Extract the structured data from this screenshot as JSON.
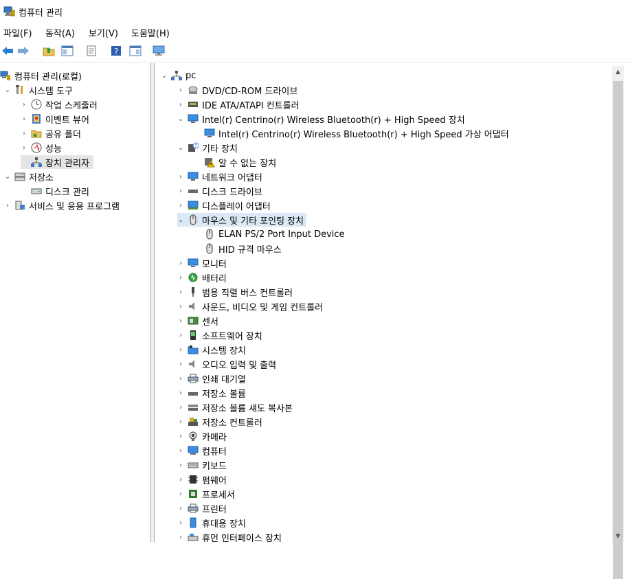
{
  "window": {
    "title": "컴퓨터 관리"
  },
  "menu": [
    "파일(F)",
    "동작(A)",
    "보기(V)",
    "도움말(H)"
  ],
  "toolbar": [
    "back-icon",
    "forward-icon",
    "up-folder-icon",
    "show-hide-tree-icon",
    "properties-icon",
    "help-icon",
    "action-pane-icon",
    "monitor-icon"
  ],
  "left_tree": {
    "root": "컴퓨터 관리(로컬)",
    "system_tools": "시스템 도구",
    "task_scheduler": "작업 스케줄러",
    "event_viewer": "이벤트 뷰어",
    "shared_folders": "공유 폴더",
    "performance": "성능",
    "device_manager": "장치 관리자",
    "storage": "저장소",
    "disk_management": "디스크 관리",
    "services_apps": "서비스 및 응용 프로그램"
  },
  "device_tree": {
    "root": "pc",
    "items": [
      "DVD/CD-ROM 드라이브",
      "IDE ATA/ATAPI 컨트롤러",
      "Intel(r) Centrino(r) Wireless Bluetooth(r) + High Speed 장치",
      "Intel(r) Centrino(r) Wireless Bluetooth(r) + High Speed 가상 어댑터",
      "기타 장치",
      "알 수 없는 장치",
      "네트워크 어댑터",
      "디스크 드라이브",
      "디스플레이 어댑터",
      "마우스 및 기타 포인팅 장치",
      "ELAN PS/2 Port Input Device",
      "HID 규격 마우스",
      "모니터",
      "배터리",
      "범용 직렬 버스 컨트롤러",
      "사운드, 비디오 및 게임 컨트롤러",
      "센서",
      "소프트웨어 장치",
      "시스템 장치",
      "오디오 입력 및 출력",
      "인쇄 대기열",
      "저장소 볼륨",
      "저장소 볼륨 섀도 복사본",
      "저장소 컨트롤러",
      "카메라",
      "컴퓨터",
      "키보드",
      "펌웨어",
      "프로세서",
      "프린터",
      "휴대용 장치",
      "휴먼 인터페이스 장치"
    ]
  }
}
